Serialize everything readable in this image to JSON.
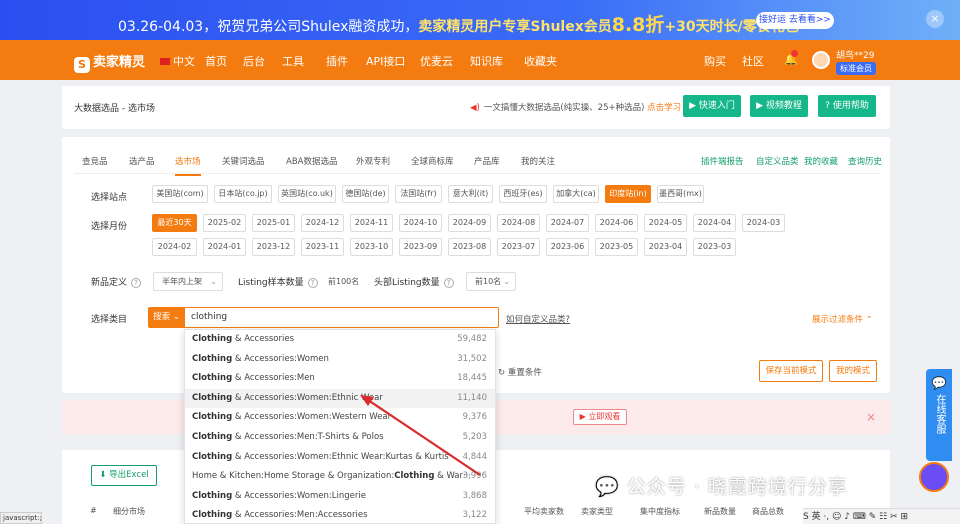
{
  "banner": {
    "text_pre": "03.26-04.03，祝贺兄弟公司Shulex融资成功，",
    "text_hl": "卖家精灵用户专享Shulex会员",
    "text_big": "8.8折",
    "text_post": "+30天时长/零食礼包",
    "pill": "接好运 去看看>>",
    "close": "×"
  },
  "nav": {
    "logo": "卖家精灵",
    "logo_mark": "S",
    "lang": "中文",
    "items": [
      "首页",
      "后台",
      "工具",
      "插件",
      "API接口",
      "优麦云",
      "知识库",
      "收藏夹"
    ],
    "right": [
      "购买",
      "社区"
    ],
    "user": "胡鸟**29",
    "badge": "标准会员"
  },
  "crumb": "大数据选品 - 选市场",
  "notice": {
    "text": "一文搞懂大数据选品(纯实操、25+种选品)",
    "link": "点击学习"
  },
  "quick_buttons": [
    "快速入门",
    "视频教程",
    "使用帮助"
  ],
  "tabs": [
    "查竞品",
    "选产品",
    "选市场",
    "关键词选品",
    "ABA数据选品",
    "外观专利",
    "全球商标库",
    "产品库",
    "我的关注"
  ],
  "active_tab": "选市场",
  "right_tabs": [
    "插件端报告",
    "自定义品类",
    "我的收藏",
    "查询历史"
  ],
  "filters": {
    "site_label": "选择站点",
    "sites": [
      "美国站(com)",
      "日本站(co.jp)",
      "英国站(co.uk)",
      "德国站(de)",
      "法国站(fr)",
      "意大利(it)",
      "西班牙(es)",
      "加拿大(ca)",
      "印度站(in)",
      "墨西哥(mx)"
    ],
    "active_site": "印度站(in)",
    "month_label": "选择月份",
    "months_row1": [
      "最近30天",
      "2025-02",
      "2025-01",
      "2024-12",
      "2024-11",
      "2024-10",
      "2024-09",
      "2024-08",
      "2024-07",
      "2024-06",
      "2024-05",
      "2024-04",
      "2024-03"
    ],
    "months_row2": [
      "2024-02",
      "2024-01",
      "2023-12",
      "2023-11",
      "2023-10",
      "2023-09",
      "2023-08",
      "2023-07",
      "2023-06",
      "2023-05",
      "2023-04",
      "2023-03"
    ],
    "active_month": "最近30天",
    "new_label": "新品定义",
    "new_value": "半年内上架",
    "listing_label": "Listing样本数量",
    "listing_value": "前100名",
    "head_label": "头部Listing数量",
    "head_value": "前10名",
    "category_label": "选择类目",
    "category_mode": "搜索",
    "search_value": "clothing",
    "custom_link": "如何自定义品类?",
    "show_filters": "展示过滤条件",
    "reset": "重置条件",
    "save_mode": "保存当前模式",
    "my_mode": "我的模式",
    "watch": "立即观看"
  },
  "dropdown": [
    {
      "bold": "Clothing",
      "rest": " & Accessories",
      "count": "59,482"
    },
    {
      "bold": "Clothing",
      "rest": " & Accessories:Women",
      "count": "31,502"
    },
    {
      "bold": "Clothing",
      "rest": " & Accessories:Men",
      "count": "18,445"
    },
    {
      "bold": "Clothing",
      "rest": " & Accessories:Women:Ethnic Wear",
      "count": "11,140"
    },
    {
      "bold": "Clothing",
      "rest": " & Accessories:Women:Western Wear",
      "count": "9,376"
    },
    {
      "bold": "Clothing",
      "rest": " & Accessories:Men:T-Shirts & Polos",
      "count": "5,203"
    },
    {
      "bold": "Clothing",
      "rest": " & Accessories:Women:Ethnic Wear:Kurtas & Kurtis",
      "count": "4,844"
    },
    {
      "pre": "Home & Kitchen:Home Storage & Organization:",
      "bold": "Clothing",
      "rest": " & War···",
      "count": "3,996"
    },
    {
      "bold": "Clothing",
      "rest": " & Accessories:Women:Lingerie",
      "count": "3,868"
    },
    {
      "bold": "Clothing",
      "rest": " & Accessories:Men:Accessories",
      "count": "3,122"
    }
  ],
  "bottom": {
    "export": "导出Excel",
    "cols": [
      "#",
      "细分市场",
      "平均卖家数",
      "卖家类型",
      "集中度指标",
      "新品数量",
      "商品总数"
    ]
  },
  "watermark": "公众号 · 晓霞跨境行分享",
  "side_service": "在线客服",
  "ime": "S 英 ·, ☺ ♪ ⌨ ✎ ☷ ✂ ⊞",
  "status": "javascript:;",
  "colors": {
    "brand": "#f47b0f",
    "green": "#15b78a",
    "banner": "#2a4ff0"
  }
}
